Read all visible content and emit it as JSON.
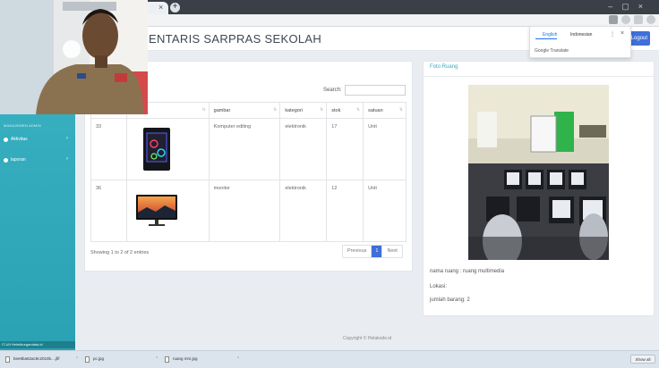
{
  "app": {
    "title": "ENTARIS SARPRAS SEKOLAH",
    "logout_label": "Logout"
  },
  "translate": {
    "lang1": "English",
    "lang2": "Indonesian",
    "brand": "Google Translate"
  },
  "sidebar": {
    "section_label": "MANAJEMEN ADMIN",
    "items": [
      {
        "label": "Aktivitas"
      },
      {
        "label": "laporan"
      }
    ],
    "footer": "IT-UII Helmiburgandata.id"
  },
  "table": {
    "search_label": "Search:",
    "columns": [
      "",
      "gambar",
      "kategori",
      "stok",
      "satuan"
    ],
    "rows": [
      {
        "id": "33",
        "gambar": "Komputer editing",
        "kategori": "elektronik",
        "stok": "17",
        "satuan": "Unit",
        "image_icon": "pc-tower-icon"
      },
      {
        "id": "36",
        "gambar": "monitor",
        "kategori": "elektronik",
        "stok": "12",
        "satuan": "Unit",
        "image_icon": "monitor-icon"
      }
    ],
    "showing": "Showing 1 to 2 of 2 entries",
    "pager": {
      "prev": "Previous",
      "current": "1",
      "next": "Next"
    }
  },
  "foto": {
    "title": "Foto Ruang",
    "nama_ruang": "nama ruang : ruang multimedia",
    "lokasi": "Lokasi:",
    "jumlah": "jumlah barang: 2"
  },
  "footer": {
    "copyright": "Copyright © Helakode.id"
  },
  "downloads": {
    "items": [
      "bee9ba62ac9c2010b....jfif",
      "pc.jpg",
      "ruang mm.jpg"
    ],
    "show_all": "Show all"
  },
  "colors": {
    "sidebar": "#2aa2b4",
    "accent": "#3f6fd8",
    "link": "#3aa9bd"
  }
}
